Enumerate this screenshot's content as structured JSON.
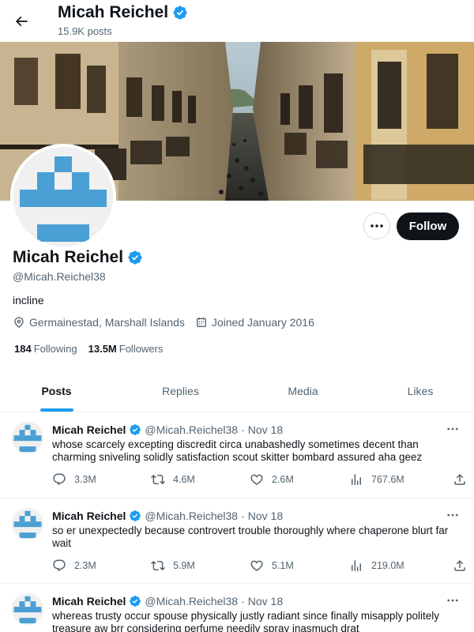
{
  "header": {
    "back_icon": "arrow-left-icon",
    "title": "Micah Reichel",
    "posts_count": "15.9K posts"
  },
  "banner": {
    "description": "street-scene-banner"
  },
  "profile": {
    "name": "Micah Reichel",
    "handle": "@Micah.Reichel38",
    "bio": "incline",
    "location": "Germainestad, Marshall Islands",
    "joined": "Joined January 2016",
    "following_count": "184",
    "following_label": "Following",
    "followers_count": "13.5M",
    "followers_label": "Followers",
    "follow_label": "Follow",
    "verified_color": "#1d9bf0",
    "avatar_color": "#4a9fd4"
  },
  "tabs": [
    {
      "label": "Posts",
      "active": true
    },
    {
      "label": "Replies",
      "active": false
    },
    {
      "label": "Media",
      "active": false
    },
    {
      "label": "Likes",
      "active": false
    }
  ],
  "tweets": [
    {
      "name": "Micah Reichel",
      "handle": "@Micah.Reichel38",
      "dot": "·",
      "date": "Nov 18",
      "text": "whose scarcely excepting discredit circa unabashedly sometimes decent than charming sniveling solidly satisfaction scout skitter bombard assured aha geez",
      "replies": "3.3M",
      "reposts": "4.6M",
      "likes": "2.6M",
      "views": "767.6M"
    },
    {
      "name": "Micah Reichel",
      "handle": "@Micah.Reichel38",
      "dot": "·",
      "date": "Nov 18",
      "text": "so er unexpectedly because controvert trouble thoroughly where chaperone blurt far wait",
      "replies": "2.3M",
      "reposts": "5.9M",
      "likes": "5.1M",
      "views": "219.0M"
    },
    {
      "name": "Micah Reichel",
      "handle": "@Micah.Reichel38",
      "dot": "·",
      "date": "Nov 18",
      "text": "whereas trusty occur spouse physically justly radiant since finally misapply politely treasure aw brr considering perfume needily spray inasmuch drat",
      "replies": "",
      "reposts": "",
      "likes": "",
      "views": ""
    }
  ]
}
